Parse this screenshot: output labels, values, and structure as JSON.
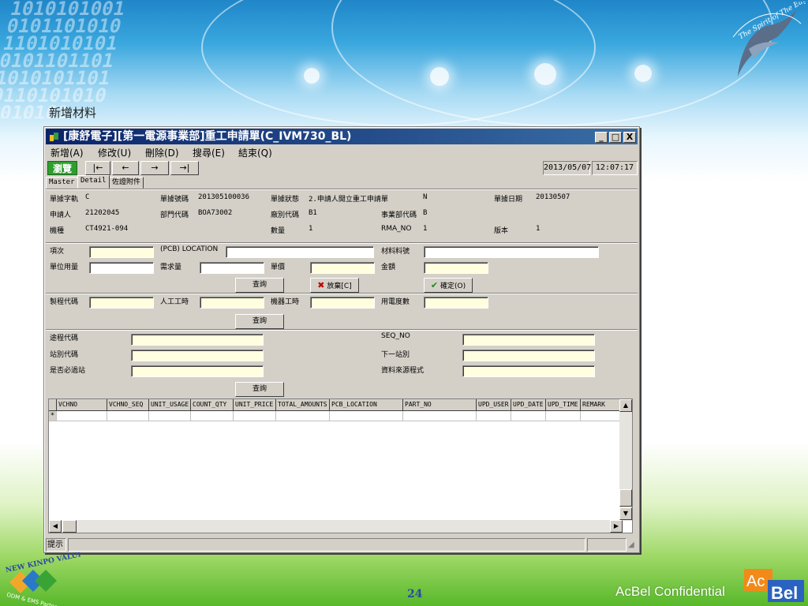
{
  "slide": {
    "title": "新增材料",
    "page_number": "24",
    "footer_confidential": "AcBel Confidential",
    "eagle_text": "The Spirit of The Eagle",
    "brand_logo_text": [
      "Ac",
      "Bel"
    ],
    "kinpo_badge_text": "NEW KINPO VALUE",
    "kinpo_badge_sub": "ODM & EMS Partner"
  },
  "window": {
    "title": "[康舒電子][第一電源事業部]重工申請單(C_IVM730_BL)",
    "controls": {
      "minimize": "_",
      "maximize": "□",
      "close": "X"
    }
  },
  "menu": [
    "新增(A)",
    "修改(U)",
    "刪除(D)",
    "搜尋(E)",
    "結束(Q)"
  ],
  "toolbar": {
    "browse_label": "瀏覽",
    "nav": [
      "|←",
      "←",
      "→",
      "→|"
    ],
    "date": "2013/05/07",
    "time": "12:07:17"
  },
  "tabs": [
    "Master",
    "Detail",
    "佐證附件"
  ],
  "header": {
    "doc_type_label": "單據字軌",
    "doc_type_value": "C",
    "doc_no_label": "單據號碼",
    "doc_no_value": "201305100036",
    "doc_status_label": "單據狀態",
    "doc_status_value": "2.申請人開立重工申請單",
    "n_value": "N",
    "doc_date_label": "單據日期",
    "doc_date_value": "20130507",
    "applicant_label": "申請人",
    "applicant_value": "21202045",
    "dept_code_label": "部門代碼",
    "dept_code_value": "BOA73002",
    "plant_code_label": "廠別代碼",
    "plant_code_value": "B1",
    "bu_code_label": "事業部代碼",
    "bu_code_value": "B",
    "model_label": "機種",
    "model_value": "CT4921-094",
    "qty_label": "數量",
    "qty_value": "1",
    "rma_label": "RMA_NO",
    "rma_value": "1",
    "version_label": "版本",
    "version_value": "1"
  },
  "material": {
    "item_label": "項次",
    "location_label": "(PCB) LOCATION",
    "part_no_label": "材料料號",
    "unit_usage_label": "單位用量",
    "demand_label": "需求量",
    "unit_price_label": "單價",
    "amount_label": "金額",
    "query_btn": "查詢",
    "cancel_btn": "放棄[C]",
    "confirm_btn": "確定(O)"
  },
  "process": {
    "process_code_label": "製程代碼",
    "labor_hours_label": "人工工時",
    "machine_hours_label": "機器工時",
    "power_label": "用電度數",
    "query_btn": "查詢"
  },
  "route": {
    "route_code_label": "途程代碼",
    "seq_no_label": "SEQ_NO",
    "station_code_label": "站別代碼",
    "next_station_label": "下一站別",
    "must_pass_label": "是否必過站",
    "data_source_label": "資料來源程式",
    "query_btn": "查詢"
  },
  "grid": {
    "columns": [
      "VCHNO",
      "VCHNO_SEQ",
      "UNIT_USAGE",
      "COUNT_QTY",
      "UNIT_PRICE",
      "TOTAL_AMOUNTS",
      "PCB_LOCATION",
      "PART_NO",
      "UPD_USER",
      "UPD_DATE",
      "UPD_TIME",
      "REMARK"
    ],
    "new_row_marker": "*"
  },
  "statusbar": {
    "label": "提示"
  },
  "icons": {
    "app": "app-icon",
    "cancel": "x-icon",
    "confirm": "check-icon"
  },
  "colors": {
    "title_bar": "#0a246a",
    "browse": "#2f9e2f",
    "field": "#ffffe0",
    "page_number": "#2a4aa0"
  }
}
